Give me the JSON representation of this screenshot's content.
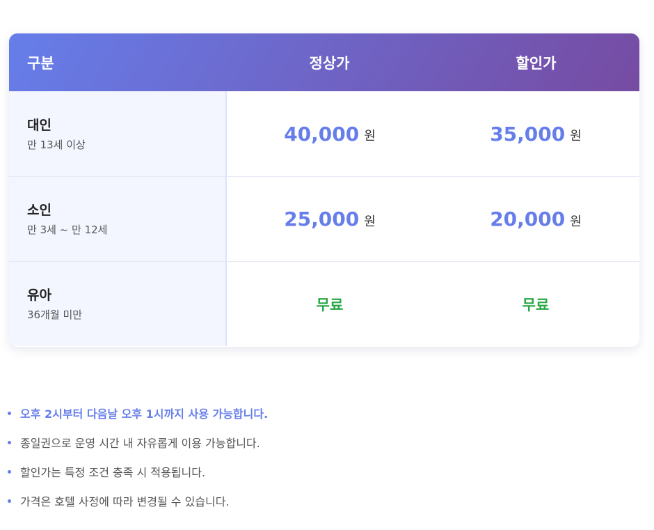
{
  "table": {
    "headers": {
      "category": "구분",
      "regular": "정상가",
      "discount": "할인가"
    },
    "rows": [
      {
        "name": "대인",
        "sub": "만 13세 이상",
        "regular": "40,000",
        "regular_unit": "원",
        "discount": "35,000",
        "discount_unit": "원"
      },
      {
        "name": "소인",
        "sub": "만 3세 ~ 만 12세",
        "regular": "25,000",
        "regular_unit": "원",
        "discount": "20,000",
        "discount_unit": "원"
      },
      {
        "name": "유아",
        "sub": "36개월 미만",
        "regular": "무료",
        "discount": "무료"
      }
    ]
  },
  "notes": [
    "오후 2시부터 다음날 오후 1시까지 사용 가능합니다.",
    "종일권으로 운영 시간 내 자유롭게 이용 가능합니다.",
    "할인가는 특정 조건 충족 시 적용됩니다.",
    "가격은 호텔 사정에 따라 변경될 수 있습니다."
  ],
  "colors": {
    "accent": "#667eea",
    "gradient_end": "#764ba2",
    "free": "#28a745",
    "label_bg": "#f3f6ff"
  }
}
